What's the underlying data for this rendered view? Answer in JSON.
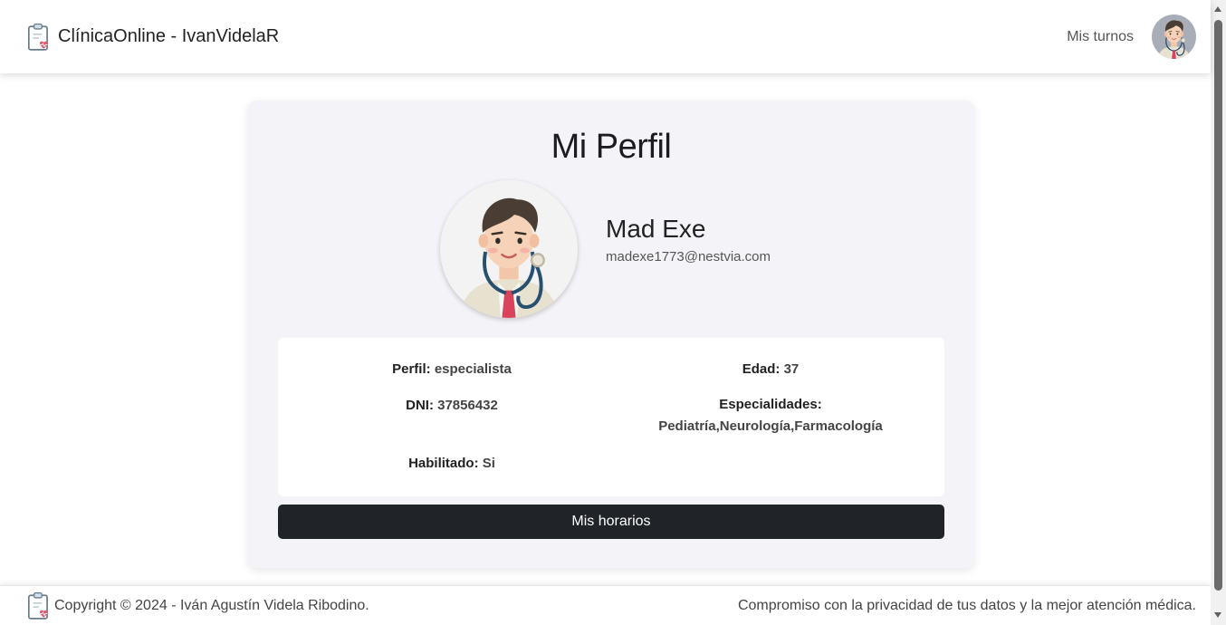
{
  "navbar": {
    "brand_title": "ClínicaOnline - IvanVidelaR",
    "logo_icon": "clipboard-heart-icon",
    "mis_turnos_label": "Mis turnos",
    "avatar_icon": "doctor-avatar-icon"
  },
  "profile": {
    "title": "Mi Perfil",
    "name": "Mad Exe",
    "email": "madexe1773@nestvia.com",
    "picture_icon": "doctor-avatar-icon"
  },
  "info": {
    "perfil_label": "Perfil:",
    "perfil_value": "especialista",
    "edad_label": "Edad:",
    "edad_value": "37",
    "dni_label": "DNI:",
    "dni_value": "37856432",
    "especialidades_label": "Especialidades:",
    "especialidades_value": "Pediatría,Neurología,Farmacología",
    "habilitado_label": "Habilitado:",
    "habilitado_value": "Si"
  },
  "button": {
    "mis_horarios_label": "Mis horarios"
  },
  "footer": {
    "copyright": "Copyright © 2024 - Iván Agustín Videla Ribodino.",
    "tagline": "Compromiso con la privacidad de tus datos y la mejor atención médica."
  },
  "colors": {
    "card_bg": "#f4f4f8",
    "button_bg": "#202328",
    "accent_heart": "#e05a6e"
  }
}
